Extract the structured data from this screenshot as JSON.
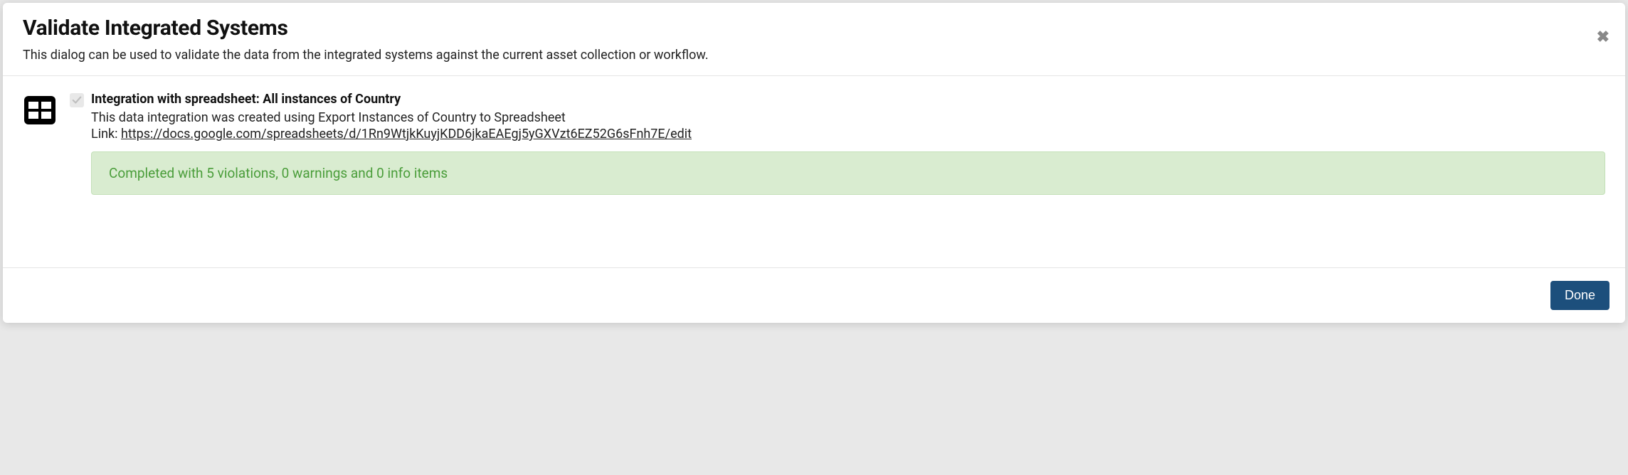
{
  "dialog": {
    "title": "Validate Integrated Systems",
    "subtitle": "This dialog can be used to validate the data from the integrated systems against the current asset collection or workflow."
  },
  "integration": {
    "title": "Integration with spreadsheet: All instances of Country",
    "description": "This data integration was created using Export Instances of Country to Spreadsheet",
    "link_label": "Link: ",
    "link_url": "https://docs.google.com/spreadsheets/d/1Rn9WtjkKuyjKDD6jkaEAEgj5yGXVzt6EZ52G6sFnh7E/edit",
    "status": "Completed with 5 violations, 0 warnings and 0 info items"
  },
  "footer": {
    "done_label": "Done"
  }
}
